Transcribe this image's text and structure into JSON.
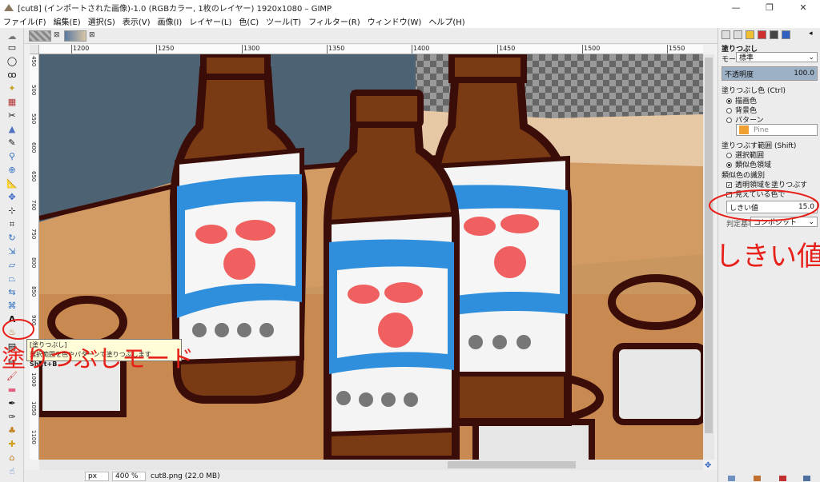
{
  "window": {
    "title": "[cut8] (インポートされた画像)-1.0 (RGBカラー, 1枚のレイヤー) 1920x1080 – GIMP",
    "minimize": "—",
    "maximize": "❐",
    "close": "✕"
  },
  "menu": [
    "ファイル(F)",
    "編集(E)",
    "選択(S)",
    "表示(V)",
    "画像(I)",
    "レイヤー(L)",
    "色(C)",
    "ツール(T)",
    "フィルター(R)",
    "ウィンドウ(W)",
    "ヘルプ(H)"
  ],
  "ruler": {
    "top_labels": [
      "1200",
      "1250",
      "1300",
      "1350",
      "1400",
      "1450",
      "1500",
      "1550"
    ],
    "left_labels": [
      "450",
      "500",
      "550",
      "600",
      "650",
      "700",
      "750",
      "800",
      "850",
      "900",
      "950",
      "1000",
      "1050",
      "1100"
    ]
  },
  "status": {
    "unit": "px",
    "zoom": "400 %",
    "file_info": "cut8.png (22.0 MB)"
  },
  "tooltip": {
    "title": "[塗りつぶし]",
    "desc": "選択範囲を色やパターンで塗りつぶします",
    "shortcut": "Shift+B"
  },
  "tool_options": {
    "heading": "塗りつぶし",
    "mode_label": "モード",
    "mode_value": "標準",
    "opacity_label": "不透明度",
    "opacity_value": "100.0",
    "fill_type_label": "塗りつぶし色 (Ctrl)",
    "fill_options": [
      "描画色",
      "背景色",
      "パターン"
    ],
    "fill_selected": 0,
    "pattern_name": "Pine",
    "area_label": "塗りつぶす範囲 (Shift)",
    "area_options": [
      "選択範囲",
      "類似色領域"
    ],
    "area_selected": 1,
    "similar_label": "類似色の識別",
    "check_transparent": "透明領域を塗りつぶす",
    "check_visible": "見えている色で",
    "threshold_label": "しきい値",
    "threshold_value": "15.0",
    "criterion_label": "判定基準",
    "criterion_value": "コンポジット"
  },
  "annotations": {
    "threshold": "しきい値",
    "fill_mode": "塗りつぶしモード"
  },
  "colors": {
    "annotation_red": "#e8201a",
    "bottle_brown": "#7a3a14",
    "label_blue": "#2f8fdc",
    "outline": "#3a0d08"
  }
}
